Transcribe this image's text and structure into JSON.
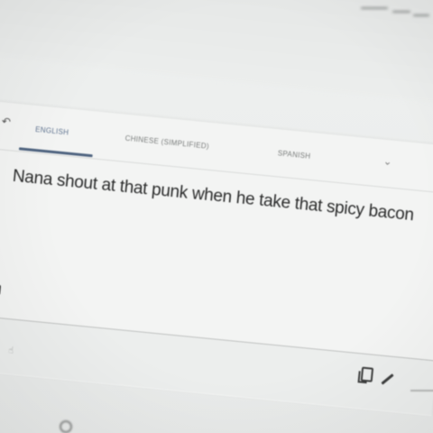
{
  "tabs": [
    {
      "label": "ENGLISH",
      "active": true
    },
    {
      "label": "CHINESE (SIMPLIFIED)",
      "active": false
    },
    {
      "label": "SPANISH",
      "active": false
    }
  ],
  "source_text": "Nana shout at that punk when he take that spicy bacon",
  "icons": {
    "back": "back-arrow-icon",
    "more_languages": "chevron-down-icon",
    "stop": "stop-icon",
    "copy": "copy-icon",
    "edit": "pencil-icon"
  },
  "colors": {
    "active_tab": "#4f6480",
    "text": "#2a2b2b"
  }
}
